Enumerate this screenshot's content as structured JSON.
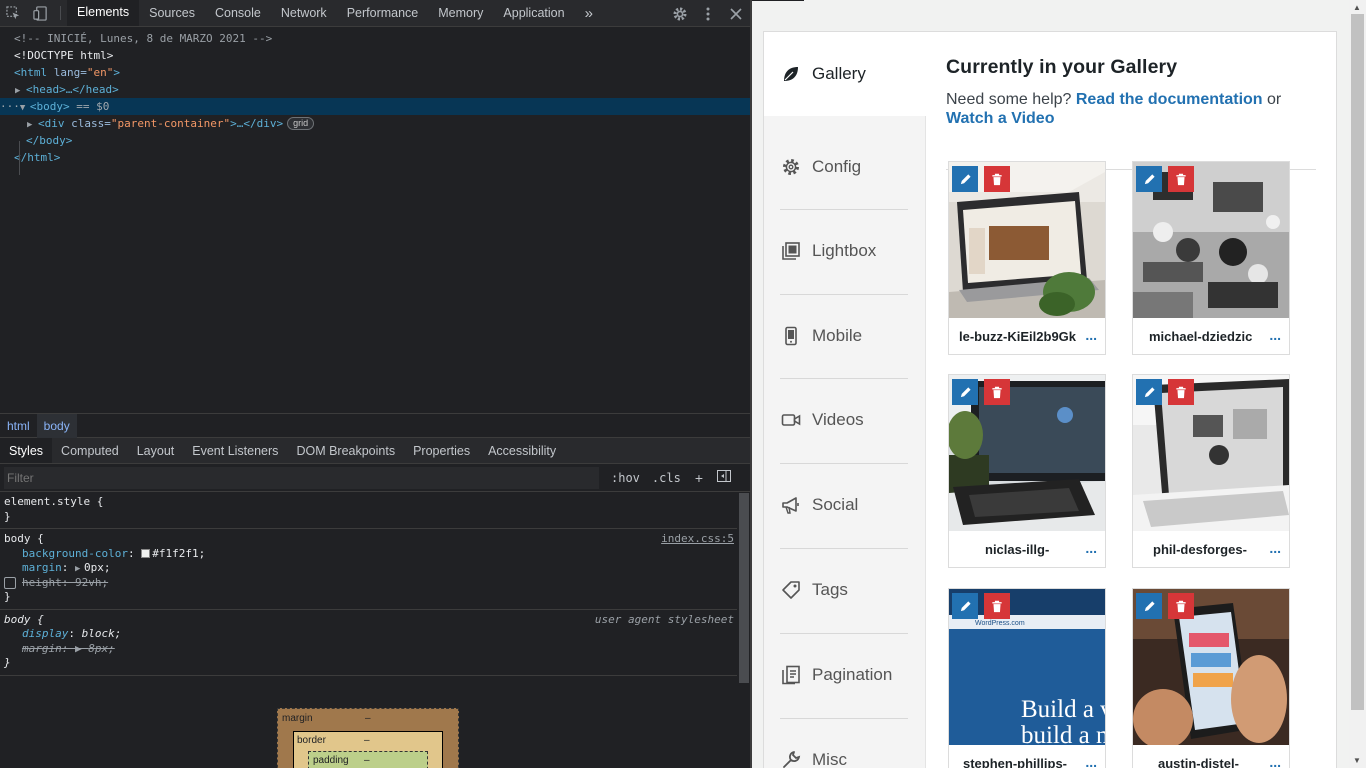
{
  "devtools": {
    "tabs": [
      "Elements",
      "Sources",
      "Console",
      "Network",
      "Performance",
      "Memory",
      "Application"
    ],
    "active_tab": "Elements",
    "more_tabs": "»",
    "dom": {
      "comment": "<!-- INICIÉ, Lunes, 8 de MARZO 2021 -->",
      "doctype": "<!DOCTYPE html>",
      "html_open_tag": "html",
      "html_lang_attr": "lang",
      "html_lang_value": "\"en\"",
      "head": "<head>…</head>",
      "body_tag": "<body>",
      "body_selected": " == $0",
      "div_tag_open": "<div ",
      "div_class_attr": "class=",
      "div_class_value": "\"parent-container\"",
      "div_tail": ">…</div>",
      "grid_badge": "grid",
      "body_close": "</body>",
      "html_close": "</html>",
      "ellipsis": "···"
    },
    "breadcrumbs": [
      "html",
      "body"
    ],
    "sub_tabs": [
      "Styles",
      "Computed",
      "Layout",
      "Event Listeners",
      "DOM Breakpoints",
      "Properties",
      "Accessibility"
    ],
    "filter_placeholder": "Filter",
    "hov": ":hov",
    "cls": ".cls",
    "rules": {
      "element_style": "element.style {",
      "close": "}",
      "body_selector": "body {",
      "body_source": "index.css:5",
      "bg_prop": "background-color",
      "bg_val": "#f1f2f1;",
      "margin_prop": "margin",
      "margin_val": "0px;",
      "height_prop": "height",
      "height_val": "92vh;",
      "ua_selector": "body {",
      "ua_source": "user agent stylesheet",
      "display_prop": "display",
      "display_val": "block;",
      "ua_margin_prop": "margin",
      "ua_margin_val": "8px;"
    },
    "boxmodel": {
      "margin": "margin",
      "border": "border",
      "padding": "padding",
      "dash": "–"
    }
  },
  "page": {
    "sidebar": [
      {
        "label": "Gallery",
        "icon": "leaf-icon"
      },
      {
        "label": "Config",
        "icon": "gear-icon"
      },
      {
        "label": "Lightbox",
        "icon": "lightbox-icon"
      },
      {
        "label": "Mobile",
        "icon": "mobile-icon"
      },
      {
        "label": "Videos",
        "icon": "video-icon"
      },
      {
        "label": "Social",
        "icon": "megaphone-icon"
      },
      {
        "label": "Tags",
        "icon": "tag-icon"
      },
      {
        "label": "Pagination",
        "icon": "pagination-icon"
      },
      {
        "label": "Misc",
        "icon": "wrench-icon"
      }
    ],
    "title": "Currently in your Gallery",
    "help_prefix": "Need some help?",
    "help_link1": "Read the documentation",
    "help_or": "or",
    "help_link2": "Watch a Video",
    "tiles": [
      {
        "name": "le-buzz-KiEil2b9Gk",
        "more": "..."
      },
      {
        "name": "michael-dziedzic",
        "more": "..."
      },
      {
        "name": "niclas-illg-",
        "more": "..."
      },
      {
        "name": "phil-desforges-",
        "more": "..."
      },
      {
        "name": "stephen-phillips-",
        "more": "..."
      },
      {
        "name": "austin-distel-",
        "more": "..."
      }
    ],
    "accent": "#2271b1",
    "delete_color": "#d63638"
  }
}
